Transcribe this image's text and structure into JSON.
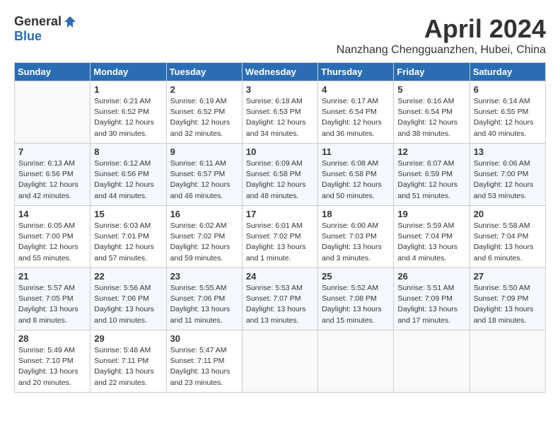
{
  "header": {
    "logo_general": "General",
    "logo_blue": "Blue",
    "month": "April 2024",
    "location": "Nanzhang Chengguanzhen, Hubei, China"
  },
  "weekdays": [
    "Sunday",
    "Monday",
    "Tuesday",
    "Wednesday",
    "Thursday",
    "Friday",
    "Saturday"
  ],
  "weeks": [
    [
      {
        "day": "",
        "info": ""
      },
      {
        "day": "1",
        "info": "Sunrise: 6:21 AM\nSunset: 6:52 PM\nDaylight: 12 hours\nand 30 minutes."
      },
      {
        "day": "2",
        "info": "Sunrise: 6:19 AM\nSunset: 6:52 PM\nDaylight: 12 hours\nand 32 minutes."
      },
      {
        "day": "3",
        "info": "Sunrise: 6:18 AM\nSunset: 6:53 PM\nDaylight: 12 hours\nand 34 minutes."
      },
      {
        "day": "4",
        "info": "Sunrise: 6:17 AM\nSunset: 6:54 PM\nDaylight: 12 hours\nand 36 minutes."
      },
      {
        "day": "5",
        "info": "Sunrise: 6:16 AM\nSunset: 6:54 PM\nDaylight: 12 hours\nand 38 minutes."
      },
      {
        "day": "6",
        "info": "Sunrise: 6:14 AM\nSunset: 6:55 PM\nDaylight: 12 hours\nand 40 minutes."
      }
    ],
    [
      {
        "day": "7",
        "info": "Sunrise: 6:13 AM\nSunset: 6:56 PM\nDaylight: 12 hours\nand 42 minutes."
      },
      {
        "day": "8",
        "info": "Sunrise: 6:12 AM\nSunset: 6:56 PM\nDaylight: 12 hours\nand 44 minutes."
      },
      {
        "day": "9",
        "info": "Sunrise: 6:11 AM\nSunset: 6:57 PM\nDaylight: 12 hours\nand 46 minutes."
      },
      {
        "day": "10",
        "info": "Sunrise: 6:09 AM\nSunset: 6:58 PM\nDaylight: 12 hours\nand 48 minutes."
      },
      {
        "day": "11",
        "info": "Sunrise: 6:08 AM\nSunset: 6:58 PM\nDaylight: 12 hours\nand 50 minutes."
      },
      {
        "day": "12",
        "info": "Sunrise: 6:07 AM\nSunset: 6:59 PM\nDaylight: 12 hours\nand 51 minutes."
      },
      {
        "day": "13",
        "info": "Sunrise: 6:06 AM\nSunset: 7:00 PM\nDaylight: 12 hours\nand 53 minutes."
      }
    ],
    [
      {
        "day": "14",
        "info": "Sunrise: 6:05 AM\nSunset: 7:00 PM\nDaylight: 12 hours\nand 55 minutes."
      },
      {
        "day": "15",
        "info": "Sunrise: 6:03 AM\nSunset: 7:01 PM\nDaylight: 12 hours\nand 57 minutes."
      },
      {
        "day": "16",
        "info": "Sunrise: 6:02 AM\nSunset: 7:02 PM\nDaylight: 12 hours\nand 59 minutes."
      },
      {
        "day": "17",
        "info": "Sunrise: 6:01 AM\nSunset: 7:02 PM\nDaylight: 13 hours\nand 1 minute."
      },
      {
        "day": "18",
        "info": "Sunrise: 6:00 AM\nSunset: 7:03 PM\nDaylight: 13 hours\nand 3 minutes."
      },
      {
        "day": "19",
        "info": "Sunrise: 5:59 AM\nSunset: 7:04 PM\nDaylight: 13 hours\nand 4 minutes."
      },
      {
        "day": "20",
        "info": "Sunrise: 5:58 AM\nSunset: 7:04 PM\nDaylight: 13 hours\nand 6 minutes."
      }
    ],
    [
      {
        "day": "21",
        "info": "Sunrise: 5:57 AM\nSunset: 7:05 PM\nDaylight: 13 hours\nand 8 minutes."
      },
      {
        "day": "22",
        "info": "Sunrise: 5:56 AM\nSunset: 7:06 PM\nDaylight: 13 hours\nand 10 minutes."
      },
      {
        "day": "23",
        "info": "Sunrise: 5:55 AM\nSunset: 7:06 PM\nDaylight: 13 hours\nand 11 minutes."
      },
      {
        "day": "24",
        "info": "Sunrise: 5:53 AM\nSunset: 7:07 PM\nDaylight: 13 hours\nand 13 minutes."
      },
      {
        "day": "25",
        "info": "Sunrise: 5:52 AM\nSunset: 7:08 PM\nDaylight: 13 hours\nand 15 minutes."
      },
      {
        "day": "26",
        "info": "Sunrise: 5:51 AM\nSunset: 7:09 PM\nDaylight: 13 hours\nand 17 minutes."
      },
      {
        "day": "27",
        "info": "Sunrise: 5:50 AM\nSunset: 7:09 PM\nDaylight: 13 hours\nand 18 minutes."
      }
    ],
    [
      {
        "day": "28",
        "info": "Sunrise: 5:49 AM\nSunset: 7:10 PM\nDaylight: 13 hours\nand 20 minutes."
      },
      {
        "day": "29",
        "info": "Sunrise: 5:48 AM\nSunset: 7:11 PM\nDaylight: 13 hours\nand 22 minutes."
      },
      {
        "day": "30",
        "info": "Sunrise: 5:47 AM\nSunset: 7:11 PM\nDaylight: 13 hours\nand 23 minutes."
      },
      {
        "day": "",
        "info": ""
      },
      {
        "day": "",
        "info": ""
      },
      {
        "day": "",
        "info": ""
      },
      {
        "day": "",
        "info": ""
      }
    ]
  ]
}
